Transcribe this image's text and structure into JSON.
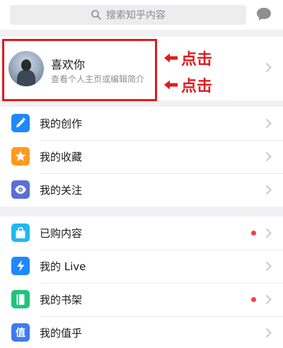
{
  "search": {
    "placeholder": "搜索知乎内容"
  },
  "profile": {
    "name": "喜欢你",
    "subtitle": "查看个人主页或编辑简介"
  },
  "annotations": {
    "click_1": "点击",
    "click_2": "点击",
    "color": "#e01b1b"
  },
  "menu_group_1": [
    {
      "label": "我的创作",
      "icon": "pencil-icon",
      "color": "#1e88ff"
    },
    {
      "label": "我的收藏",
      "icon": "star-icon",
      "color": "#ff9a1f"
    },
    {
      "label": "我的关注",
      "icon": "eye-icon",
      "color": "#5b6fd6"
    }
  ],
  "menu_group_2": [
    {
      "label": "已购内容",
      "icon": "shopping-bag-icon",
      "color": "#22b8f0",
      "badge": true
    },
    {
      "label": "我的 Live",
      "icon": "lightning-icon",
      "color": "#1e88ff",
      "badge": false
    },
    {
      "label": "我的书架",
      "icon": "book-icon",
      "color": "#1fc47c",
      "badge": true
    },
    {
      "label": "我的值乎",
      "icon": "zhi-icon",
      "icon_text": "值",
      "color": "#3d7cf0",
      "badge": false
    }
  ]
}
